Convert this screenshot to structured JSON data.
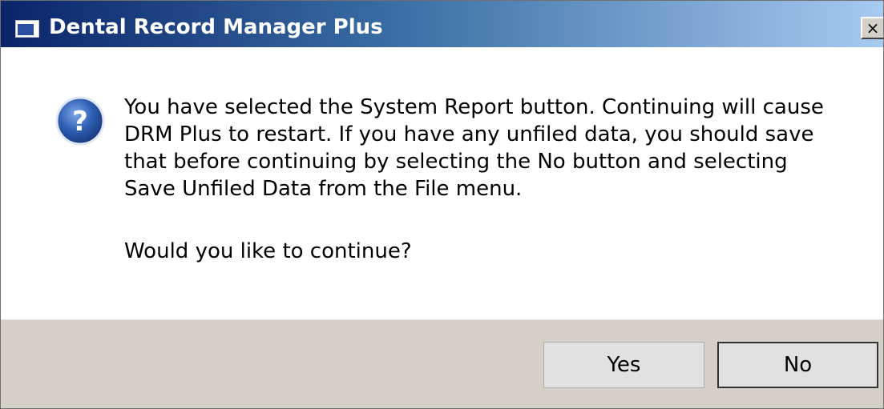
{
  "window": {
    "title": "Dental Record Manager Plus",
    "close_label": "×"
  },
  "dialog": {
    "icon": "question-icon",
    "message": "You have selected the System Report button.  Continuing will cause DRM Plus to restart.  If you have any unfiled data, you should save that before continuing by selecting the No button and selecting Save Unfiled Data from the File menu.",
    "question": "Would you like to continue?"
  },
  "buttons": {
    "yes_label": "Yes",
    "no_label": "No"
  },
  "colors": {
    "titlebar_start": "#0a246a",
    "titlebar_end": "#a6caf0",
    "button_bar": "#d4d0c8",
    "question_icon": "#2f5fb3"
  }
}
